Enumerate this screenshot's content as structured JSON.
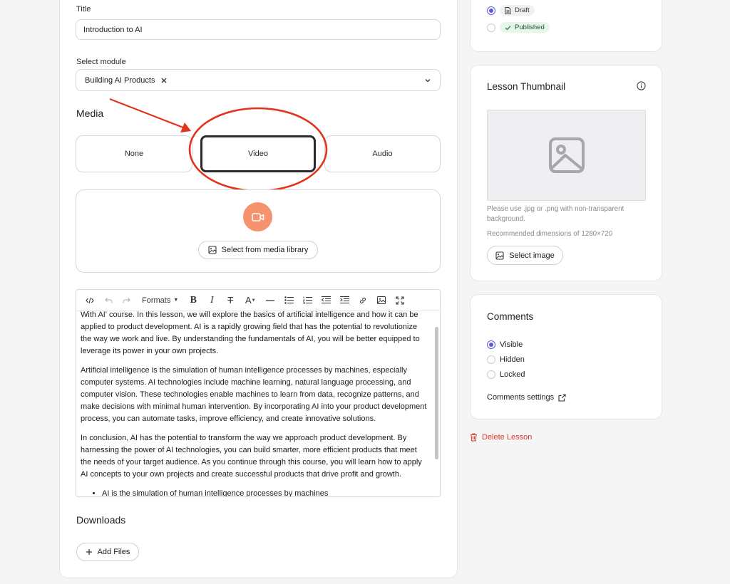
{
  "form": {
    "title_label": "Title",
    "title_value": "Introduction to AI",
    "module_label": "Select module",
    "module_value": "Building AI Products",
    "module_remove_icon": "close-icon",
    "module_dropdown_icon": "chevron-down-icon"
  },
  "media": {
    "heading": "Media",
    "options": [
      "None",
      "Video",
      "Audio"
    ],
    "selected": "Video",
    "annotation_color": "#e2341d",
    "video_icon": "video-camera-icon",
    "library_button": "Select from media library"
  },
  "editor": {
    "toolbar": {
      "formats_label": "Formats",
      "icons": [
        "code-icon",
        "undo-icon",
        "redo-icon",
        "bold-icon",
        "italic-icon",
        "strikethrough-icon",
        "text-color-icon",
        "horizontal-rule-icon",
        "bullet-list-icon",
        "numbered-list-icon",
        "outdent-icon",
        "indent-icon",
        "link-icon",
        "image-icon",
        "fullscreen-icon"
      ]
    },
    "paragraphs": [
      "With AI' course. In this lesson, we will explore the basics of artificial intelligence and how it can be applied to product development. AI is a rapidly growing field that has the potential to revolutionize the way we work and live. By understanding the fundamentals of AI, you will be better equipped to leverage its power in your own projects.",
      "Artificial intelligence is the simulation of human intelligence processes by machines, especially computer systems. AI technologies include machine learning, natural language processing, and computer vision. These technologies enable machines to learn from data, recognize patterns, and make decisions with minimal human intervention. By incorporating AI into your product development process, you can automate tasks, improve efficiency, and create innovative solutions.",
      "In conclusion, AI has the potential to transform the way we approach product development. By harnessing the power of AI technologies, you can build smarter, more efficient products that meet the needs of your target audience. As you continue through this course, you will learn how to apply AI concepts to your own projects and create successful products that drive profit and growth."
    ],
    "bullets": [
      "AI is the simulation of human intelligence processes by machines"
    ]
  },
  "downloads": {
    "heading": "Downloads",
    "add_button": "Add Files"
  },
  "status": {
    "options": [
      {
        "label": "Draft",
        "checked": true
      },
      {
        "label": "Published",
        "checked": false
      }
    ],
    "published_color": "#e6f7ea"
  },
  "thumbnail": {
    "heading": "Lesson Thumbnail",
    "hint": "Please use .jpg or .png with non-transparent background.",
    "dimensions": "Recommended dimensions of 1280×720",
    "button": "Select image"
  },
  "comments": {
    "heading": "Comments",
    "options": [
      {
        "label": "Visible",
        "checked": true
      },
      {
        "label": "Hidden",
        "checked": false
      },
      {
        "label": "Locked",
        "checked": false
      }
    ],
    "settings_link": "Comments settings"
  },
  "delete": {
    "label": "Delete Lesson",
    "color": "#d93a2b"
  }
}
